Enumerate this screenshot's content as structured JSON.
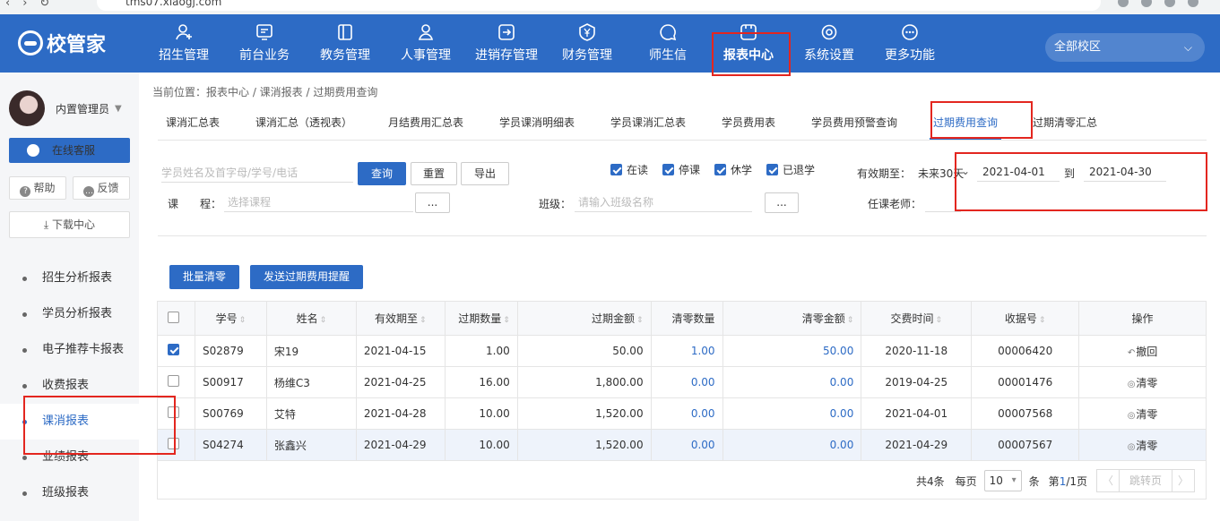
{
  "browser": {
    "url": "tms07.xiaogj.com"
  },
  "header": {
    "logo": "校管家",
    "menu": [
      {
        "label": "招生管理",
        "icon": "user-plus-icon"
      },
      {
        "label": "前台业务",
        "icon": "monitor-icon"
      },
      {
        "label": "教务管理",
        "icon": "book-icon"
      },
      {
        "label": "人事管理",
        "icon": "person-icon"
      },
      {
        "label": "进销存管理",
        "icon": "inventory-icon"
      },
      {
        "label": "财务管理",
        "icon": "yen-shield-icon"
      },
      {
        "label": "师生信",
        "icon": "chat-icon"
      },
      {
        "label": "报表中心",
        "icon": "report-icon"
      },
      {
        "label": "系统设置",
        "icon": "settings-icon"
      },
      {
        "label": "更多功能",
        "icon": "more-icon"
      }
    ],
    "campus": "全部校区"
  },
  "sidebar": {
    "user_name": "内置管理员",
    "service": "在线客服",
    "help": "帮助",
    "feedback": "反馈",
    "download": "下载中心",
    "items": [
      {
        "label": "招生分析报表"
      },
      {
        "label": "学员分析报表"
      },
      {
        "label": "电子推荐卡报表"
      },
      {
        "label": "收费报表"
      },
      {
        "label": "课消报表"
      },
      {
        "label": "业绩报表"
      },
      {
        "label": "班级报表"
      }
    ]
  },
  "breadcrumb": "当前位置：报表中心 / 课消报表 / 过期费用查询",
  "tabs": [
    "课消汇总表",
    "课消汇总（透视表）",
    "月结费用汇总表",
    "学员课消明细表",
    "学员课消汇总表",
    "学员费用表",
    "学员费用预警查询",
    "过期费用查询",
    "过期清零汇总"
  ],
  "filter": {
    "search_placeholder": "学员姓名及首字母/学号/电话",
    "query": "查询",
    "reset": "重置",
    "export": "导出",
    "checks": [
      {
        "label": "在读",
        "checked": true
      },
      {
        "label": "停课",
        "checked": true
      },
      {
        "label": "休学",
        "checked": true
      },
      {
        "label": "已退学",
        "checked": true
      }
    ],
    "expiry_label": "有效期至：",
    "expiry_select": "未来30天",
    "date_from": "2021-04-01",
    "to_label": "到",
    "date_to": "2021-04-30",
    "course_label": "课　　程：",
    "course_placeholder": "选择课程",
    "class_label": "班级：",
    "class_placeholder": "请输入班级名称",
    "ellipsis": "...",
    "teacher_label": "任课老师："
  },
  "actions": {
    "batch_clear": "批量清零",
    "send_reminder": "发送过期费用提醒"
  },
  "table": {
    "headers": [
      "学号",
      "姓名",
      "有效期至",
      "过期数量",
      "过期金额",
      "清零数量",
      "清零金额",
      "交费时间",
      "收据号",
      "操作"
    ],
    "rows": [
      {
        "checked": true,
        "id": "S02879",
        "name": "宋19",
        "expiry": "2021-04-15",
        "qty": "1.00",
        "amount": "50.00",
        "clear_qty": "1.00",
        "clear_amount": "50.00",
        "pay_time": "2020-11-18",
        "receipt": "00006420",
        "op": "撤回"
      },
      {
        "checked": false,
        "id": "S00917",
        "name": "杨维C3",
        "expiry": "2021-04-25",
        "qty": "16.00",
        "amount": "1,800.00",
        "clear_qty": "0.00",
        "clear_amount": "0.00",
        "pay_time": "2019-04-25",
        "receipt": "00001476",
        "op": "清零"
      },
      {
        "checked": false,
        "id": "S00769",
        "name": "艾特",
        "expiry": "2021-04-28",
        "qty": "10.00",
        "amount": "1,520.00",
        "clear_qty": "0.00",
        "clear_amount": "0.00",
        "pay_time": "2021-04-01",
        "receipt": "00007568",
        "op": "清零"
      },
      {
        "checked": false,
        "id": "S04274",
        "name": "张鑫兴",
        "expiry": "2021-04-29",
        "qty": "10.00",
        "amount": "1,520.00",
        "clear_qty": "0.00",
        "clear_amount": "0.00",
        "pay_time": "2021-04-29",
        "receipt": "00007567",
        "op": "清零"
      }
    ]
  },
  "pagination": {
    "total": "共4条",
    "per_page_label": "每页",
    "per_page": "10",
    "unit": "条",
    "page_prefix": "第",
    "page_current": "1",
    "page_suffix": "/1页",
    "prev": "〈",
    "jump": "跳转页",
    "next": "〉"
  },
  "colors": {
    "brand": "#2d6bc5",
    "highlight": "#e3261f"
  }
}
